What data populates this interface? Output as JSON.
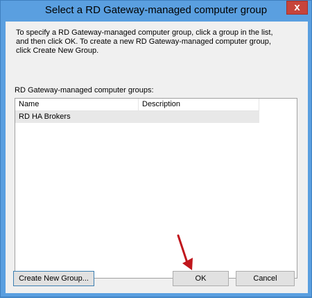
{
  "window": {
    "title": "Select a RD Gateway-managed computer group",
    "close_glyph": "x"
  },
  "dialog": {
    "instructions": "To specify a RD Gateway-managed computer group, click a group in the list, and then click OK. To create a new RD Gateway-managed computer group, click Create New Group.",
    "list_label": "RD Gateway-managed computer groups:",
    "columns": [
      {
        "label": "Name"
      },
      {
        "label": "Description"
      }
    ],
    "rows": [
      {
        "name": "RD HA Brokers",
        "description": ""
      }
    ]
  },
  "buttons": {
    "create_label": "Create New Group...",
    "ok_label": "OK",
    "cancel_label": "Cancel"
  },
  "colors": {
    "titlebar": "#5a9fe0",
    "close": "#c7443b",
    "dialog_bg": "#f0f0f0",
    "selected_row": "#e8e8e8",
    "annotation_arrow": "#c0161c"
  },
  "icons": {
    "close": "close-icon",
    "annotation": "red-arrow-icon"
  }
}
